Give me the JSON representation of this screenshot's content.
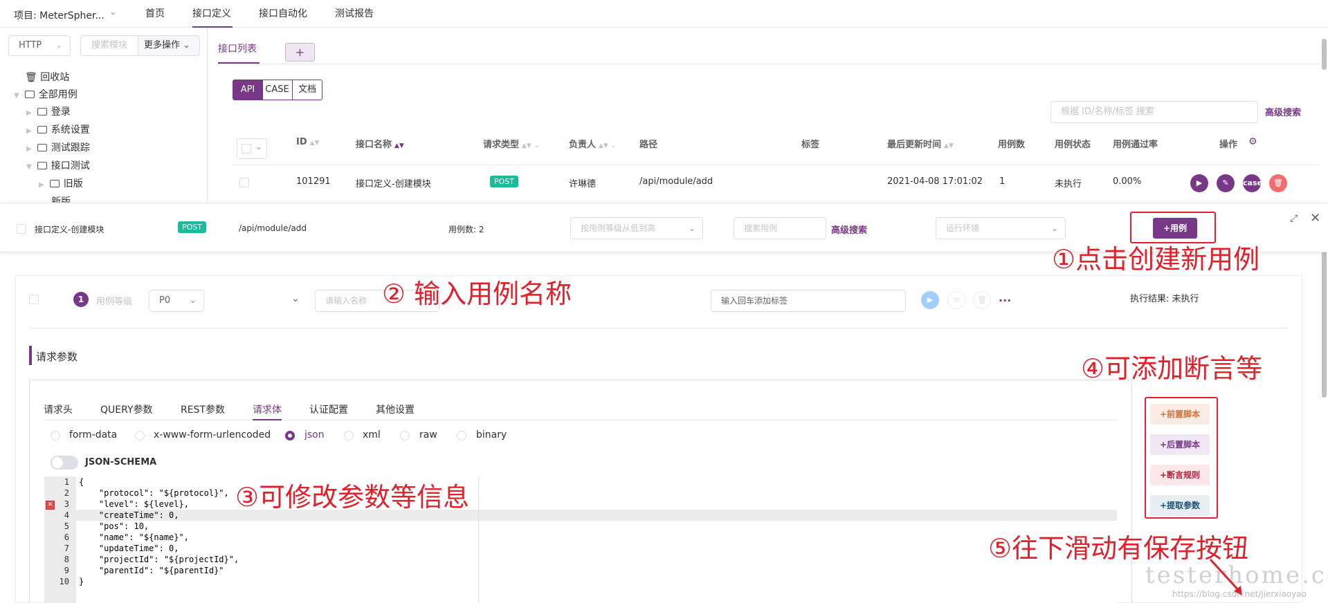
{
  "topnav": {
    "project": "项目: MeterSpher...",
    "items": [
      "首页",
      "接口定义",
      "接口自动化",
      "测试报告"
    ]
  },
  "sidebar": {
    "protocol": "HTTP",
    "search_placeholder": "搜索模块",
    "more_ops": "更多操作",
    "tree": [
      "回收站",
      "全部用例",
      "登录",
      "系统设置",
      "测试跟踪",
      "接口测试",
      "旧版",
      "新版"
    ]
  },
  "main": {
    "tab_list": "接口列表",
    "tab_add": "+",
    "segments": [
      "API",
      "CASE",
      "文档"
    ],
    "search_placeholder": "根据 ID/名称/标签 搜索",
    "advanced_search": "高级搜索",
    "headers": [
      "ID",
      "接口名称",
      "请求类型",
      "负责人",
      "路径",
      "标签",
      "最后更新时间",
      "用例数",
      "用例状态",
      "用例通过率",
      "操作"
    ],
    "row": {
      "id": "101291",
      "name": "接口定义-创建模块",
      "method": "POST",
      "owner": "许琳德",
      "path": "/api/module/add",
      "updated": "2021-04-08 17:01:02",
      "cases": "1",
      "status": "未执行",
      "pass_rate": "0.00%",
      "case_label": "case"
    }
  },
  "drawer": {
    "name": "接口定义-创建模块",
    "method": "POST",
    "path": "/api/module/add",
    "case_count": "用例数: 2",
    "sort_placeholder": "按用例等级从低到高",
    "search_case_placeholder": "搜索用例",
    "advanced_search": "高级搜索",
    "env_placeholder": "运行环境",
    "add_case": "+用例"
  },
  "case": {
    "index": "1",
    "level_label": "用例等级",
    "level_value": "P0",
    "name_placeholder": "请输入名称",
    "tag_placeholder": "输入回车添加标签",
    "more": "...",
    "exec_result": "执行结果: 未执行",
    "section_title": "请求参数",
    "param_tabs": [
      "请求头",
      "QUERY参数",
      "REST参数",
      "请求体",
      "认证配置",
      "其他设置"
    ],
    "body_types": [
      "form-data",
      "x-www-form-urlencoded",
      "json",
      "xml",
      "raw",
      "binary"
    ],
    "json_schema": "JSON-SCHEMA",
    "side_buttons": [
      "+前置脚本",
      "+后置脚本",
      "+断言规则",
      "+提取参数"
    ]
  },
  "code_lines": [
    "{",
    "    \"protocol\": \"${protocol}\",",
    "    \"level\": ${level},",
    "    \"createTime\": 0,",
    "    \"pos\": 10,",
    "    \"name\": \"${name}\",",
    "    \"updateTime\": 0,",
    "    \"projectId\": \"${projectId}\",",
    "    \"parentId\": \"${parentId}\"",
    "}"
  ],
  "annotations": {
    "a1": "①点击创建新用例",
    "a2": "② 输入用例名称",
    "a3": "③可修改参数等信息",
    "a4": "④可添加断言等",
    "a5": "⑤往下滑动有保存按钮"
  },
  "watermark": "testerhome.com",
  "watermark2": "https://blog.csdn.net/jierxiaoyao",
  "colors": {
    "accent": "#783887",
    "annotation": "#e0202a",
    "post": "#1abc9c"
  }
}
